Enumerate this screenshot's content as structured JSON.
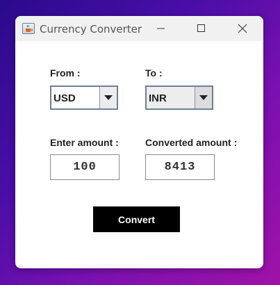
{
  "window": {
    "title": "Currency Converter",
    "icon": "java-cup-icon"
  },
  "titlebar_controls": {
    "minimize_icon": "minimize-icon",
    "maximize_icon": "maximize-icon",
    "close_icon": "close-icon"
  },
  "form": {
    "from_label": "From :",
    "to_label": "To :",
    "from_currency": "USD",
    "to_currency": "INR",
    "amount_label": "Enter amount :",
    "converted_label": "Converted amount :",
    "amount_value": "100",
    "converted_value": "8413",
    "convert_button": "Convert"
  },
  "colors": {
    "button_bg": "#000000",
    "button_text": "#ffffff",
    "combo_border": "#6e7f97"
  }
}
